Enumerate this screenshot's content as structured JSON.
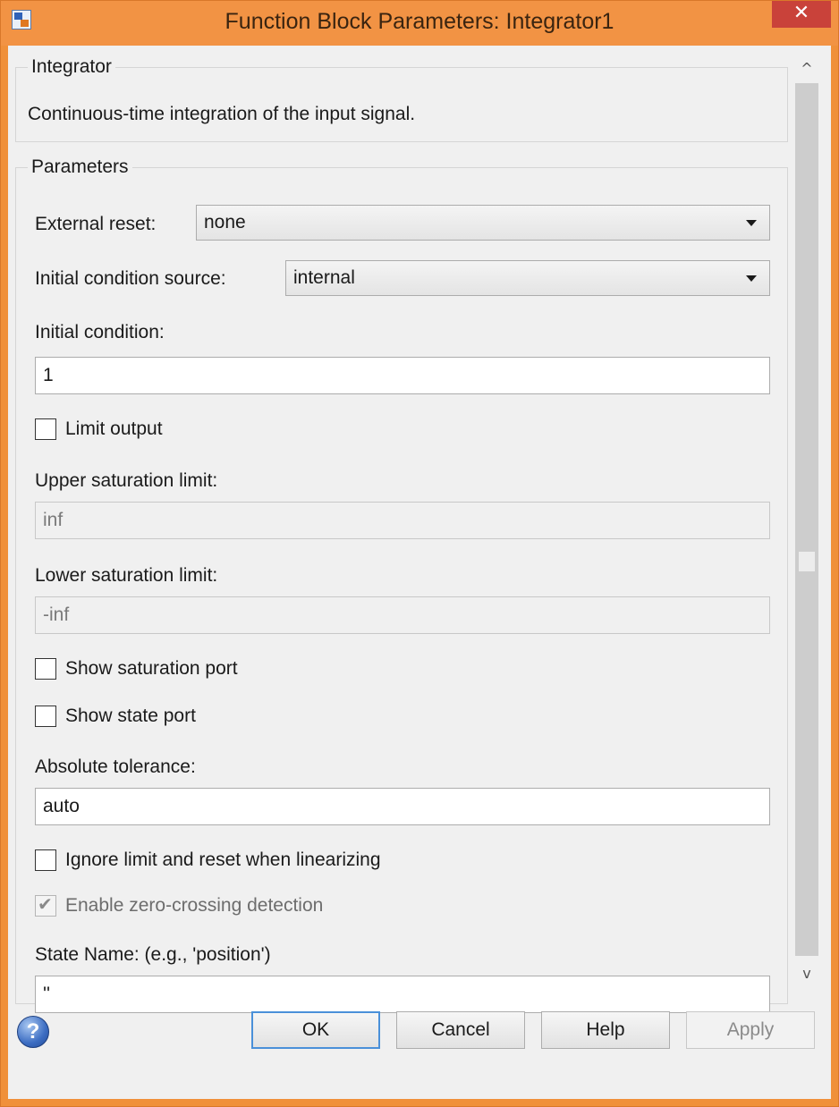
{
  "window": {
    "title": "Function Block Parameters: Integrator1",
    "close_glyph": "✕",
    "accent_color": "#f29344"
  },
  "description_group": {
    "legend": "Integrator",
    "text": "Continuous-time integration of the input signal."
  },
  "parameters": {
    "legend": "Parameters",
    "external_reset": {
      "label": "External reset:",
      "value": "none"
    },
    "ic_source": {
      "label": "Initial condition source:",
      "value": "internal"
    },
    "initial_condition": {
      "label": "Initial condition:",
      "value": "1"
    },
    "limit_output": {
      "label": "Limit output",
      "checked": false
    },
    "upper_sat": {
      "label": "Upper saturation limit:",
      "value": "inf",
      "disabled": true
    },
    "lower_sat": {
      "label": "Lower saturation limit:",
      "value": "-inf",
      "disabled": true
    },
    "show_sat_port": {
      "label": "Show saturation port",
      "checked": false
    },
    "show_state_port": {
      "label": "Show state port",
      "checked": false
    },
    "abs_tol": {
      "label": "Absolute tolerance:",
      "value": "auto"
    },
    "ignore_limit": {
      "label": "Ignore limit and reset when linearizing",
      "checked": false
    },
    "zero_crossing": {
      "label": "Enable zero-crossing detection",
      "checked": true,
      "disabled": true
    },
    "state_name": {
      "label": "State Name: (e.g., 'position')",
      "value": "''"
    }
  },
  "scrollbar": {
    "up_glyph": "^",
    "down_glyph": "v"
  },
  "footer": {
    "help_icon_glyph": "?",
    "ok": "OK",
    "cancel": "Cancel",
    "help": "Help",
    "apply": "Apply"
  }
}
